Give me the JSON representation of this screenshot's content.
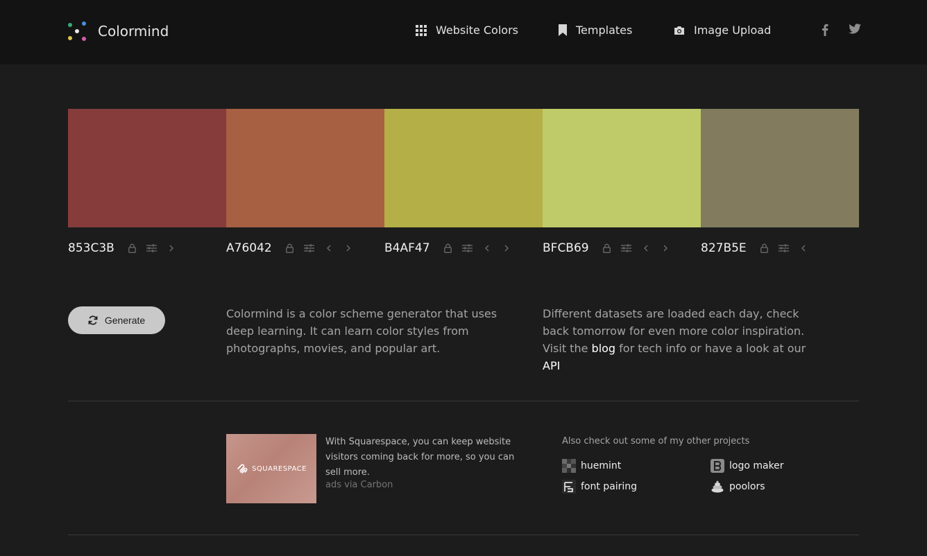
{
  "header": {
    "brand": "Colormind",
    "nav": [
      {
        "label": "Website Colors",
        "icon": "grid-icon"
      },
      {
        "label": "Templates",
        "icon": "bookmark-icon"
      },
      {
        "label": "Image Upload",
        "icon": "camera-icon"
      }
    ],
    "social": [
      {
        "icon": "facebook-icon"
      },
      {
        "icon": "twitter-icon"
      }
    ]
  },
  "palette": [
    {
      "hex": "853C3B",
      "color": "#853C3B"
    },
    {
      "hex": "A76042",
      "color": "#A76042"
    },
    {
      "hex": "B4AF47",
      "color": "#B4AF47"
    },
    {
      "hex": "BFCB69",
      "color": "#BFCB69"
    },
    {
      "hex": "827B5E",
      "color": "#827B5E"
    }
  ],
  "generate": {
    "label": "Generate",
    "icon": "refresh-icon"
  },
  "intro": {
    "text": "Colormind is a color scheme generator that uses deep learning. It can learn color styles from photographs, movies, and popular art."
  },
  "datasets": {
    "text_before": "Different datasets are loaded each day, check back tomorrow for even more color inspiration. Visit the ",
    "blog_link": "blog",
    "text_middle": " for tech info or have a look at our ",
    "api_link": "API"
  },
  "ad": {
    "brand": "SQUARESPACE",
    "text": "With Squarespace, you can keep website visitors coming back for more, so you can sell more.",
    "via": "ads via Carbon"
  },
  "projects": {
    "title": "Also check out some of my other projects",
    "items": [
      {
        "label": "huemint",
        "icon": "huemint-icon"
      },
      {
        "label": "logo maker",
        "icon": "logo-maker-icon"
      },
      {
        "label": "font pairing",
        "icon": "font-pairing-icon"
      },
      {
        "label": "poolors",
        "icon": "poolors-icon"
      }
    ]
  }
}
